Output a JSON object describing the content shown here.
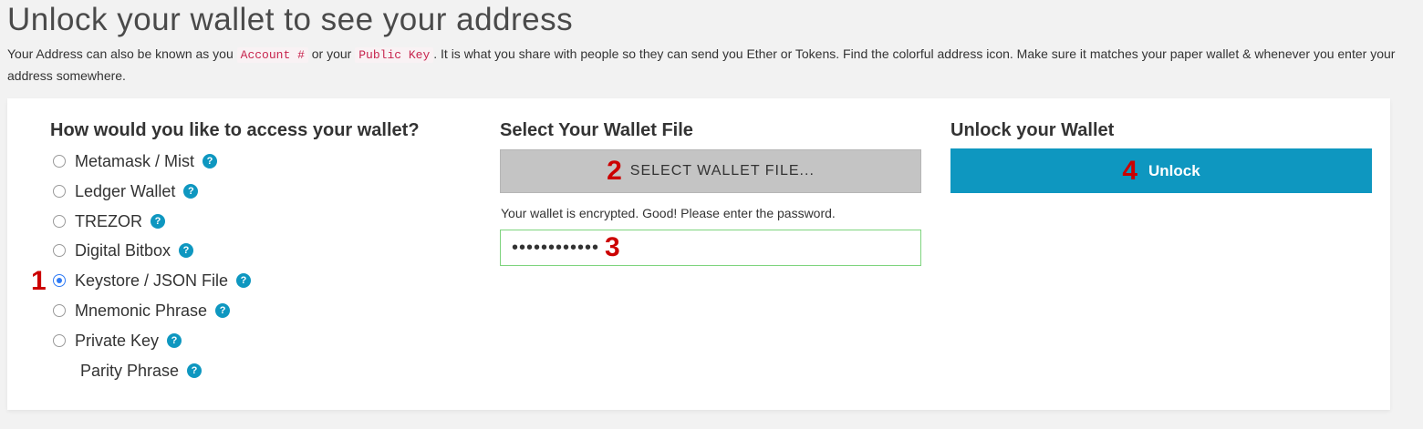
{
  "header": {
    "title": "Unlock your wallet to see your address",
    "intro_before": "Your Address can also be known as you ",
    "code_account": "Account #",
    "intro_mid": " or your ",
    "code_public_key": "Public Key",
    "intro_after": ". It is what you share with people so they can send you Ether or Tokens. Find the colorful address icon. Make sure it matches your paper wallet & whenever you enter your address somewhere."
  },
  "access": {
    "title": "How would you like to access your wallet?",
    "options": [
      {
        "label": "Metamask / Mist",
        "selected": false
      },
      {
        "label": "Ledger Wallet",
        "selected": false
      },
      {
        "label": "TREZOR",
        "selected": false
      },
      {
        "label": "Digital Bitbox",
        "selected": false
      },
      {
        "label": "Keystore / JSON File",
        "selected": true
      },
      {
        "label": "Mnemonic Phrase",
        "selected": false
      },
      {
        "label": "Private Key",
        "selected": false
      },
      {
        "label": "Parity Phrase",
        "selected": false
      }
    ],
    "help_glyph": "?"
  },
  "wallet_file": {
    "title": "Select Your Wallet File",
    "button_label": "SELECT WALLET FILE...",
    "encrypted_message": "Your wallet is encrypted. Good! Please enter the password.",
    "password_value": "••••••••••••"
  },
  "unlock": {
    "title": "Unlock your Wallet",
    "button_label": "Unlock"
  },
  "markers": [
    "1",
    "2",
    "3",
    "4"
  ],
  "colors": {
    "accent": "#0e97c0",
    "marker": "#cc0000",
    "radio_checked": "#2f7bf5",
    "input_valid_border": "#7ed47e"
  }
}
